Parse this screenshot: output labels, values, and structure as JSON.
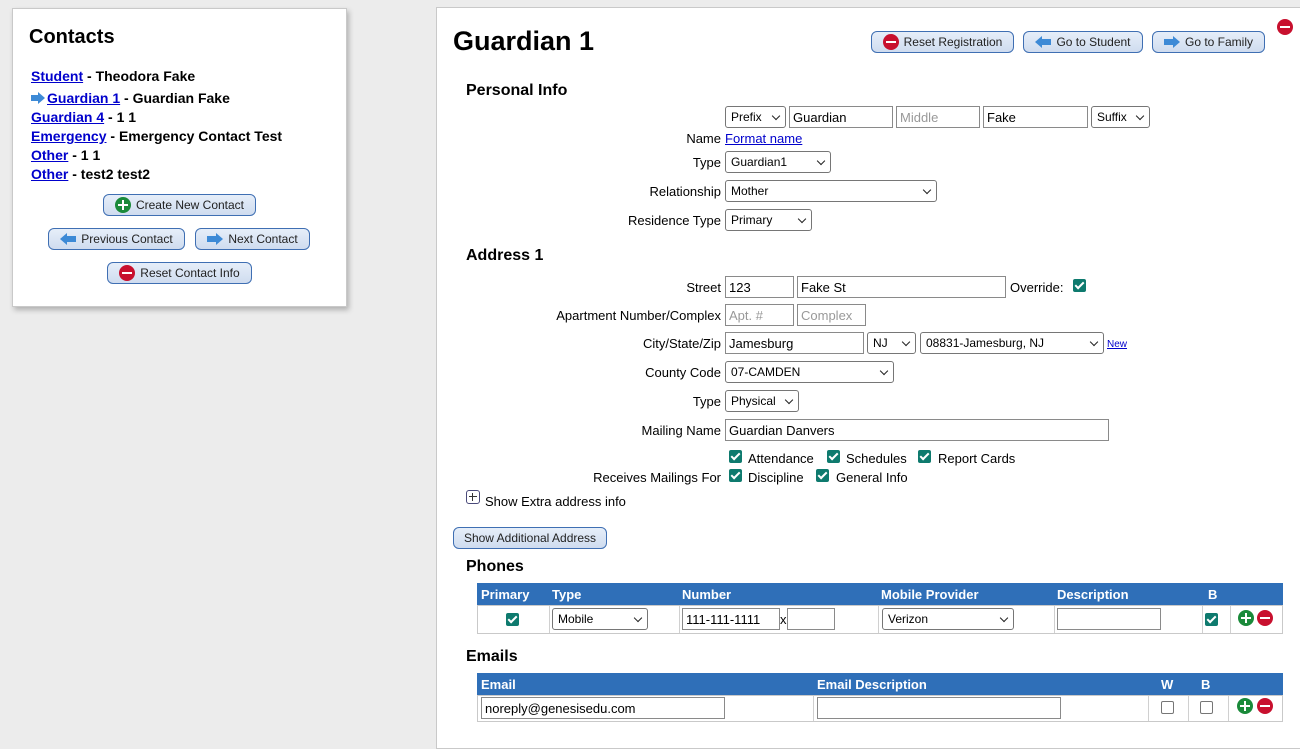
{
  "contacts": {
    "title": "Contacts",
    "items": [
      {
        "link": "Student",
        "name": "Theodora Fake"
      },
      {
        "link": "Guardian 1",
        "name": "Guardian Fake"
      },
      {
        "link": "Guardian 4",
        "name": "1 1"
      },
      {
        "link": "Emergency",
        "name": "Emergency Contact Test"
      },
      {
        "link": "Other",
        "name": "1 1"
      },
      {
        "link": "Other",
        "name": "test2 test2"
      }
    ],
    "separator": " - ",
    "create_button": "Create New Contact",
    "prev_button": "Previous Contact",
    "next_button": "Next Contact",
    "reset_button": "Reset Contact Info"
  },
  "header": {
    "title": "Guardian 1",
    "reset_registration": "Reset Registration",
    "go_to_student": "Go to Student",
    "go_to_family": "Go to Family"
  },
  "personal": {
    "section_title": "Personal Info",
    "prefix": "Prefix",
    "first_name": "Guardian",
    "middle_placeholder": "Middle",
    "last_name": "Fake",
    "suffix": "Suffix",
    "name_label": "Name",
    "format_name_link": "Format name",
    "type_label": "Type",
    "type_value": "Guardian1",
    "relationship_label": "Relationship",
    "relationship_value": "Mother",
    "residence_label": "Residence Type",
    "residence_value": "Primary"
  },
  "address": {
    "section_title": "Address 1",
    "street_label": "Street",
    "street_number": "123",
    "street_name": "Fake St",
    "override_label": "Override:",
    "apt_label": "Apartment Number/Complex",
    "apt_placeholder": "Apt. #",
    "complex_placeholder": "Complex",
    "city_label": "City/State/Zip",
    "city": "Jamesburg",
    "state": "NJ",
    "zip": "08831-Jamesburg, NJ",
    "new_link": "New",
    "county_label": "County Code",
    "county_value": "07-CAMDEN",
    "type_label": "Type",
    "type_value": "Physical",
    "mailing_name_label": "Mailing Name",
    "mailing_name": "Guardian Danvers",
    "receives_label": "Receives Mailings For",
    "mailings": [
      "Attendance",
      "Schedules",
      "Report Cards",
      "Discipline",
      "General Info"
    ],
    "extra_info": "Show Extra address info",
    "additional_button": "Show Additional Address"
  },
  "phones": {
    "section_title": "Phones",
    "headers": [
      "Primary",
      "Type",
      "Number",
      "Mobile Provider",
      "Description",
      "B"
    ],
    "row": {
      "type": "Mobile",
      "number": "111-111-1111",
      "ext_sep": "x",
      "ext": "",
      "provider": "Verizon",
      "description": ""
    }
  },
  "emails": {
    "section_title": "Emails",
    "headers": [
      "Email",
      "Email Description",
      "W",
      "B"
    ],
    "row": {
      "email": "noreply@genesisedu.com",
      "description": ""
    }
  }
}
